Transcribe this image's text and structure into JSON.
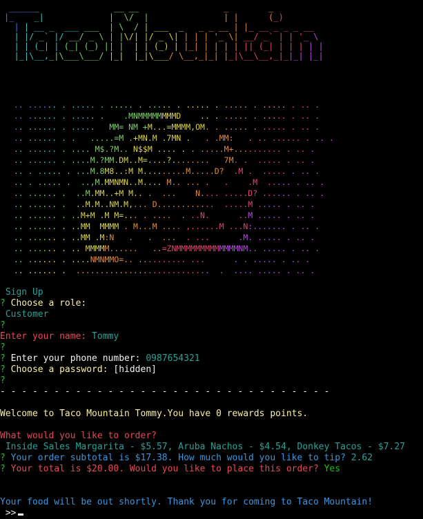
{
  "colors": {
    "background": "#000000",
    "q_mark": "#16c60c",
    "prompt_yellow": "#f9f1a5",
    "prompt_red": "#e74856",
    "answer_cyan": "#3a96dd",
    "teal": "#2aa198",
    "white": "#f2f2f2",
    "yellow": "#f9f1a5",
    "green": "#16c60c"
  },
  "banner_lines": [
    " ______               __ __                 _        _",
    "|_    _|             |  \\/  |               | |      (_)",
    "  | | __ _  ___ ___  | \\  / | ___  _   _ _ __ | |_ __ _ _ _ __",
    "  | |/ _` |/ __/ _ \\ | |\\/| |/ _ \\| | | | '_ \\| __/ _` | | '_ \\",
    "  | | (_| | (_| (_) || |  | | (_) | |_| | | | | || (_| | | | | |",
    "  |_|\\__,_|\\___\\___/ |_|  |_|\\___/ \\__,_|_| |_|\\__\\__,_|_|_| |_|"
  ],
  "art_lines": [
    "  .. ...... . ..... . ..... . ..... . ..... . ..... . ..... . .. .",
    "  .. ...... . ..... .    .MNMMMMMMMMD    .. . ..... . ..... . .. .",
    "  .. ...... . .....   MM= NM +M...=MMMM,OM. . ..... . ..... . .. .",
    "  .. ...... . .   .....=M .+MN.M .7MN .   . .MM:   . .. ...... . .. .",
    "  .. ...... . .... M$.?M.. N$$M .... . . .....M+.......... . .. .",
    "  .. ...... . ....M.?MM.DM..M=....?........   7M. .  ..... . .. .",
    "  .. . ..... . ...M.8M8..:M M.........M.....D?  .M .  ..... . .. .",
    "  .. . ..... .  ..,M.MMNMN..M.... M.. ... .   .    .M  ..... . .. .",
    "  .. ...... .  ..M.MM..+M M.. .  ...    N.... .....D? ...... . .. .",
    "  .. ...... .  ..M.M..NM.M,... D............  .....M ..... . .. .",
    "  .. ...... . ..M+M .M M=... . ....  . ..N.      ..M ..... . .. .",
    "  .. ...... . ..MM  MMMM . M...M .... ,......M ...N:....... . .. .",
    "  .. ...... . ..MM .M:N   .   .  ...  . ...      .M. ..... . .. .",
    "  .. ...... . .. MMMMM......   ..=ZNMMMMMMMMMMMMMNM.. ..... . .. .",
    "  .. ...... . ....NMNMMO=.. .......... ...      . . ..... . .. .",
    "  .. ...... .  ............................  .  .... ..... . .. ."
  ],
  "session": {
    "signup_title": " Sign Up",
    "q_mark": "?",
    "role_prompt": " Choose a role:",
    "role_value": " Customer",
    "name_prompt": "Enter your name:",
    "name_value": " Tommy",
    "phone_prompt": " Enter your phone number:",
    "phone_value": " 0987654321",
    "password_prompt": " Choose a password:",
    "password_value": " [hidden]",
    "divider": "- - - - - - - - - - - - - - - - - - - - - - - - - - - - - - -",
    "welcome": "Welcome to Taco Mountain Tommy.You have 0 rewards points.",
    "order_prompt": "What would you like to order?",
    "order_value": " Inside Sales Margarita - $5.57, Aruba Nachos - $4.54, Donkey Tacos - $7.27",
    "subtotal_prompt": " Your order subtotal is $17.38. How much would you like to tip?",
    "subtotal_value": " 2.62",
    "total_prompt": " Your total is $20.00. Would you like to place this order?",
    "total_value": " Yes",
    "goodbye": "Your food will be out shortly. Thank you for coming to Taco Mountain!",
    "input_prompt": " >>"
  }
}
